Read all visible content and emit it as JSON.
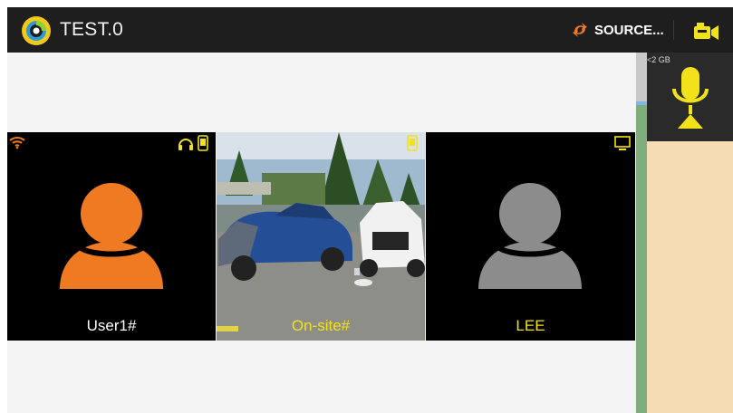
{
  "header": {
    "title": "TEST.0",
    "source_label": "SOURCE...",
    "logo_icon": "swirl-logo-icon",
    "source_icon": "sync-arrows-icon",
    "camera_icon": "camera-switch-icon"
  },
  "tiles": [
    {
      "label": "User1#",
      "label_color": "#ffffff",
      "avatar_color": "#f07a22",
      "icons": [
        "wifi-icon",
        "headset-icon",
        "mobile-phone-icon"
      ]
    },
    {
      "label": "On-site#",
      "label_color": "#f2e21a",
      "content": "crash-scene-photo",
      "icons": [
        "mobile-phone-icon"
      ]
    },
    {
      "label": "LEE",
      "label_color": "#f2e21a",
      "avatar_color": "#8c8c8c",
      "icons": [
        "monitor-icon"
      ]
    }
  ],
  "side_panel": {
    "storage_text": "<2 GB",
    "mic_icon": "microphone-icon"
  },
  "colors": {
    "accent_yellow": "#f2e21a",
    "accent_orange": "#f07a22",
    "topbar": "#1e1e1e",
    "side_panel": "#f6dcb4"
  }
}
